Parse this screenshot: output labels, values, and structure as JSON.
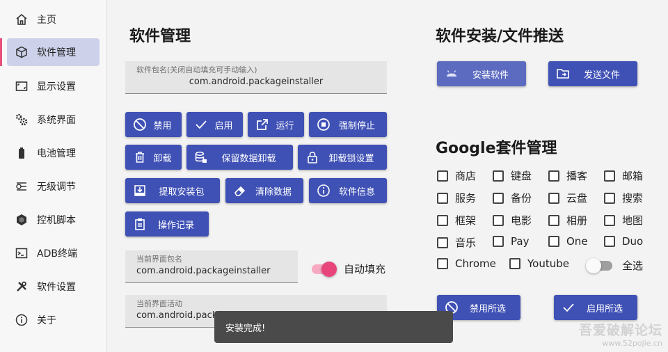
{
  "sidebar": {
    "items": [
      {
        "label": "主页",
        "icon": "home-icon"
      },
      {
        "label": "软件管理",
        "icon": "package-icon"
      },
      {
        "label": "显示设置",
        "icon": "screen-icon"
      },
      {
        "label": "系统界面",
        "icon": "gears-icon"
      },
      {
        "label": "电池管理",
        "icon": "battery-icon"
      },
      {
        "label": "无级调节",
        "icon": "sliders-icon"
      },
      {
        "label": "控机脚本",
        "icon": "hexagon-icon"
      },
      {
        "label": "ADB终端",
        "icon": "terminal-icon"
      },
      {
        "label": "软件设置",
        "icon": "tools-icon"
      },
      {
        "label": "关于",
        "icon": "info-icon"
      }
    ],
    "active_index": 1
  },
  "software": {
    "title": "软件管理",
    "package_field": {
      "label": "软件包名(关闭自动填充可手动输入)",
      "value": "com.android.packageinstaller"
    },
    "buttons": {
      "disable": "禁用",
      "enable": "启用",
      "run": "运行",
      "force_stop": "强制停止",
      "uninstall": "卸载",
      "uninstall_keep_data": "保留数据卸载",
      "uninstall_lock": "卸载锁设置",
      "extract_apk": "提取安装包",
      "clear_data": "清除数据",
      "app_info": "软件信息",
      "operation_log": "操作记录"
    },
    "current_package": {
      "label": "当前界面包名",
      "value": "com.android.packageinstaller"
    },
    "autofill": {
      "label": "自动填充",
      "on": true
    },
    "current_activity": {
      "label": "当前界面活动",
      "value": "com.android.packa"
    }
  },
  "install": {
    "title": "软件安装/文件推送",
    "install_button": "安装软件",
    "send_button": "发送文件"
  },
  "google": {
    "title": "Google套件管理",
    "options": [
      "商店",
      "键盘",
      "播客",
      "邮箱",
      "服务",
      "备份",
      "云盘",
      "搜索",
      "框架",
      "电影",
      "相册",
      "地图",
      "音乐",
      "Pay",
      "One",
      "Duo",
      "Chrome",
      "Youtube"
    ],
    "select_all": {
      "label": "全选",
      "on": false
    },
    "disable_selected": "禁用所选",
    "enable_selected": "启用所选"
  },
  "toast": "安装完成!",
  "watermark": {
    "line1": "吾爱破解论坛",
    "line2": "www.52pojie.cn"
  },
  "colors": {
    "accent": "#3f51b5",
    "active_nav": "#cdd2ea",
    "indicator": "#e84f7b",
    "toggle_on": "#e8457a"
  }
}
